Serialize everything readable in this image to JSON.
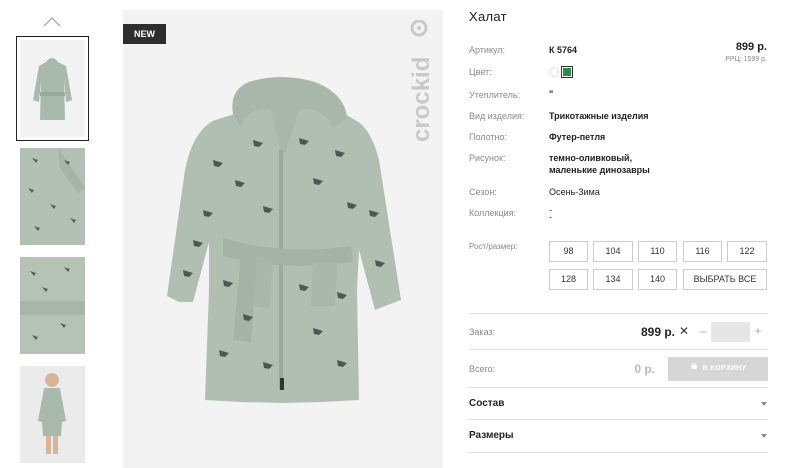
{
  "product": {
    "title": "Халат",
    "badge": "NEW",
    "brand": "crockid",
    "price": "899 р.",
    "rrc": "РРЦ: 1599 р."
  },
  "attributes": [
    {
      "label": "Артикул:",
      "value": "К 5764",
      "bold": true
    },
    {
      "label": "Цвет:"
    },
    {
      "label": "Утеплитель:",
      "value": "\"",
      "bold": true
    },
    {
      "label": "Вид изделия:",
      "value": "Трикотажные изделия",
      "bold": true
    },
    {
      "label": "Полотно:",
      "value": "Футер-петля",
      "bold": true
    },
    {
      "label": "Рисунок:",
      "value_lines": [
        "темно-оливковый,",
        "маленькие динозавры"
      ],
      "bold": true
    },
    {
      "label": "Сезон:",
      "value": "Осень-Зима",
      "bold": false
    },
    {
      "label": "Коллекция:",
      "value_lines": [
        "-",
        "-"
      ],
      "bold": false
    },
    {
      "label": "Рост/размер:"
    }
  ],
  "colors": [
    "#ffffff",
    "#2f8a4f"
  ],
  "sizes": [
    "98",
    "104",
    "110",
    "116",
    "122",
    "128",
    "134",
    "140"
  ],
  "select_all": "ВЫБРАТЬ ВСЕ",
  "order": {
    "label": "Заказ:",
    "price": "899 р.",
    "remove": "✕",
    "minus": "–",
    "plus": "+",
    "qty": ""
  },
  "total": {
    "label": "Всего:",
    "price": "0 р.",
    "cart_button": "В КОРЗИНУ"
  },
  "accordions": [
    "Состав",
    "Размеры"
  ],
  "thumbnails": [
    "robe-front",
    "robe-detail-1",
    "robe-detail-2",
    "child-wearing-robe"
  ]
}
